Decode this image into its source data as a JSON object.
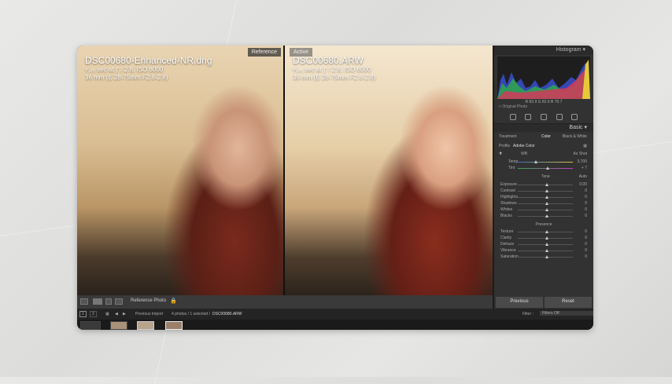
{
  "photos": {
    "reference": {
      "tag": "Reference",
      "filename": "DSC00680-Enhanced-NR.dng",
      "exposure": "¹⁄₁₂₅ sec at ƒ / 2.8, ISO 8000",
      "lens": "36 mm (E 28-75mm F2.8-2.8)"
    },
    "active": {
      "tag": "Active",
      "filename": "DSC00680.ARW",
      "exposure": "¹⁄₁₂₅ sec at ƒ / 2.8, ISO 8000",
      "lens": "36 mm (E 28-75mm F2.8-2.8)"
    }
  },
  "toolbar": {
    "view_label": "Reference Photo"
  },
  "panel": {
    "histogram_title": "Histogram",
    "histogram_values": "R 83.9  G 82.6  B 70.7",
    "original_photo": "Original Photo",
    "basic_title": "Basic",
    "treatment_label": "Treatment",
    "treatment_color": "Color",
    "treatment_bw": "Black & White",
    "profile_label": "Profile",
    "profile_value": "Adobe Color",
    "wb_label": "WB",
    "wb_value": "As Shot",
    "temp_label": "Temp",
    "temp_value": "3,700",
    "tint_label": "Tint",
    "tint_value": "+ 7",
    "tone_label": "Tone",
    "tone_auto": "Auto",
    "tone_rows": [
      {
        "label": "Exposure",
        "value": "0.00"
      },
      {
        "label": "Contrast",
        "value": "0"
      },
      {
        "label": "Highlights",
        "value": "0"
      },
      {
        "label": "Shadows",
        "value": "0"
      },
      {
        "label": "Whites",
        "value": "0"
      },
      {
        "label": "Blacks",
        "value": "0"
      }
    ],
    "presence_label": "Presence",
    "presence_rows": [
      {
        "label": "Texture",
        "value": "0"
      },
      {
        "label": "Clarity",
        "value": "0"
      },
      {
        "label": "Dehaze",
        "value": "0"
      },
      {
        "label": "Vibrance",
        "value": "0"
      },
      {
        "label": "Saturation",
        "value": "0"
      }
    ],
    "previous_button": "Previous",
    "reset_button": "Reset"
  },
  "filmbar": {
    "page1": "1",
    "page2": "2",
    "source": "Previous Import",
    "count": "4 photos / 1 selected /",
    "selected": "DSC00680.ARW",
    "filter_label": "Filter :",
    "filter_value": "Filters Off"
  },
  "colors": {
    "panel_bg": "#323232",
    "window_bg": "#1c1c1c"
  }
}
